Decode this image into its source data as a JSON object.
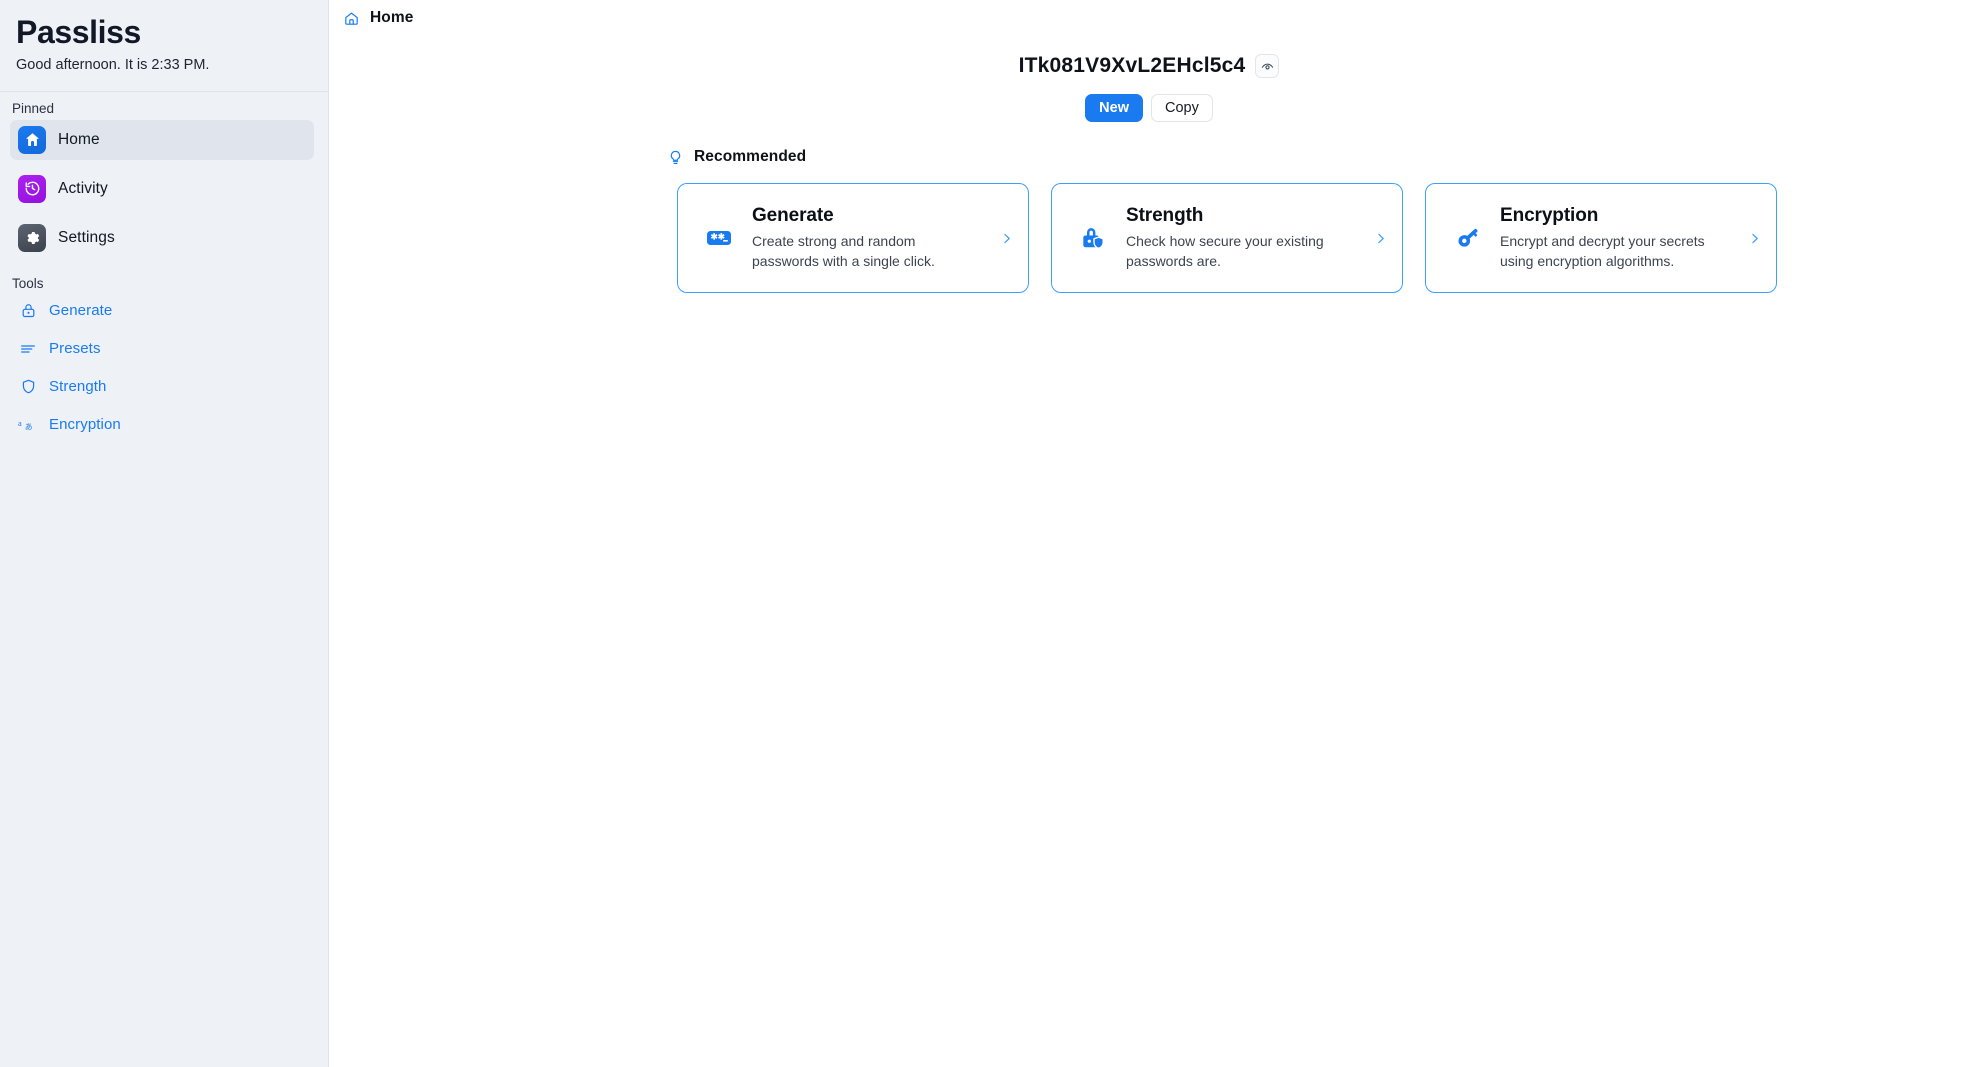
{
  "sidebar": {
    "brand": "Passliss",
    "greeting": "Good afternoon. It is 2:33 PM.",
    "pinned_label": "Pinned",
    "tools_label": "Tools",
    "pinned": [
      {
        "label": "Home",
        "icon": "home-icon",
        "active": true,
        "tile_color": "#1a7bf0"
      },
      {
        "label": "Activity",
        "icon": "history-icon",
        "active": false,
        "tile_color": "#ab22ef"
      },
      {
        "label": "Settings",
        "icon": "gear-icon",
        "active": false,
        "tile_color": "#4b525d"
      }
    ],
    "tools": [
      {
        "label": "Generate",
        "icon": "lock-icon"
      },
      {
        "label": "Presets",
        "icon": "list-icon"
      },
      {
        "label": "Strength",
        "icon": "shield-icon"
      },
      {
        "label": "Encryption",
        "icon": "translate-icon"
      }
    ]
  },
  "breadcrumb": {
    "icon": "home-outline-icon",
    "label": "Home"
  },
  "password": {
    "value": "ITk081V9XvL2EHcl5c4",
    "reveal_icon": "eye-icon",
    "new_label": "New",
    "copy_label": "Copy"
  },
  "recommended": {
    "icon": "lightbulb-icon",
    "label": "Recommended",
    "cards": [
      {
        "title": "Generate",
        "description": "Create strong and random passwords with a single click.",
        "icon": "password-field-icon",
        "chevron": "chevron-right-icon"
      },
      {
        "title": "Strength",
        "description": "Check how secure your existing passwords are.",
        "icon": "lock-shield-icon",
        "chevron": "chevron-right-icon"
      },
      {
        "title": "Encryption",
        "description": "Encrypt and decrypt your secrets using encryption algorithms.",
        "icon": "key-icon",
        "chevron": "chevron-right-icon"
      }
    ]
  },
  "colors": {
    "accent": "#1a7bf0",
    "card_border": "#3ca0ff",
    "sidebar_bg": "#eef1f6",
    "activity_purple": "#ab22ef"
  }
}
